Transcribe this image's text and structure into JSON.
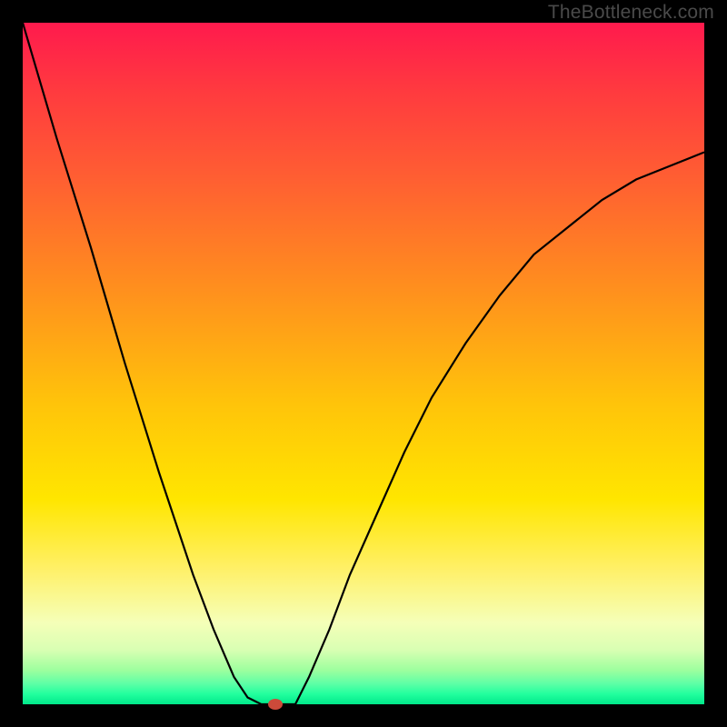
{
  "watermark": "TheBottleneck.com",
  "chart_data": {
    "type": "line",
    "title": "",
    "xlabel": "",
    "ylabel": "",
    "xlim": [
      0,
      100
    ],
    "ylim": [
      0,
      100
    ],
    "series": [
      {
        "name": "bottleneck-curve",
        "x": [
          0,
          5,
          10,
          15,
          20,
          25,
          28,
          31,
          33,
          35,
          36,
          37,
          38,
          39,
          40,
          42,
          45,
          48,
          52,
          56,
          60,
          65,
          70,
          75,
          80,
          85,
          90,
          95,
          100
        ],
        "y": [
          100,
          83,
          67,
          50,
          34,
          19,
          11,
          4,
          1,
          0,
          0,
          0,
          0,
          0,
          0,
          4,
          11,
          19,
          28,
          37,
          45,
          53,
          60,
          66,
          70,
          74,
          77,
          79,
          81
        ]
      }
    ],
    "marker": {
      "x": 37,
      "y": 0
    },
    "background": {
      "type": "vertical-gradient",
      "stops": [
        {
          "pos": 0,
          "color": "#ff1a4d"
        },
        {
          "pos": 0.56,
          "color": "#ffe600"
        },
        {
          "pos": 1.0,
          "color": "#00e88a"
        }
      ]
    }
  }
}
